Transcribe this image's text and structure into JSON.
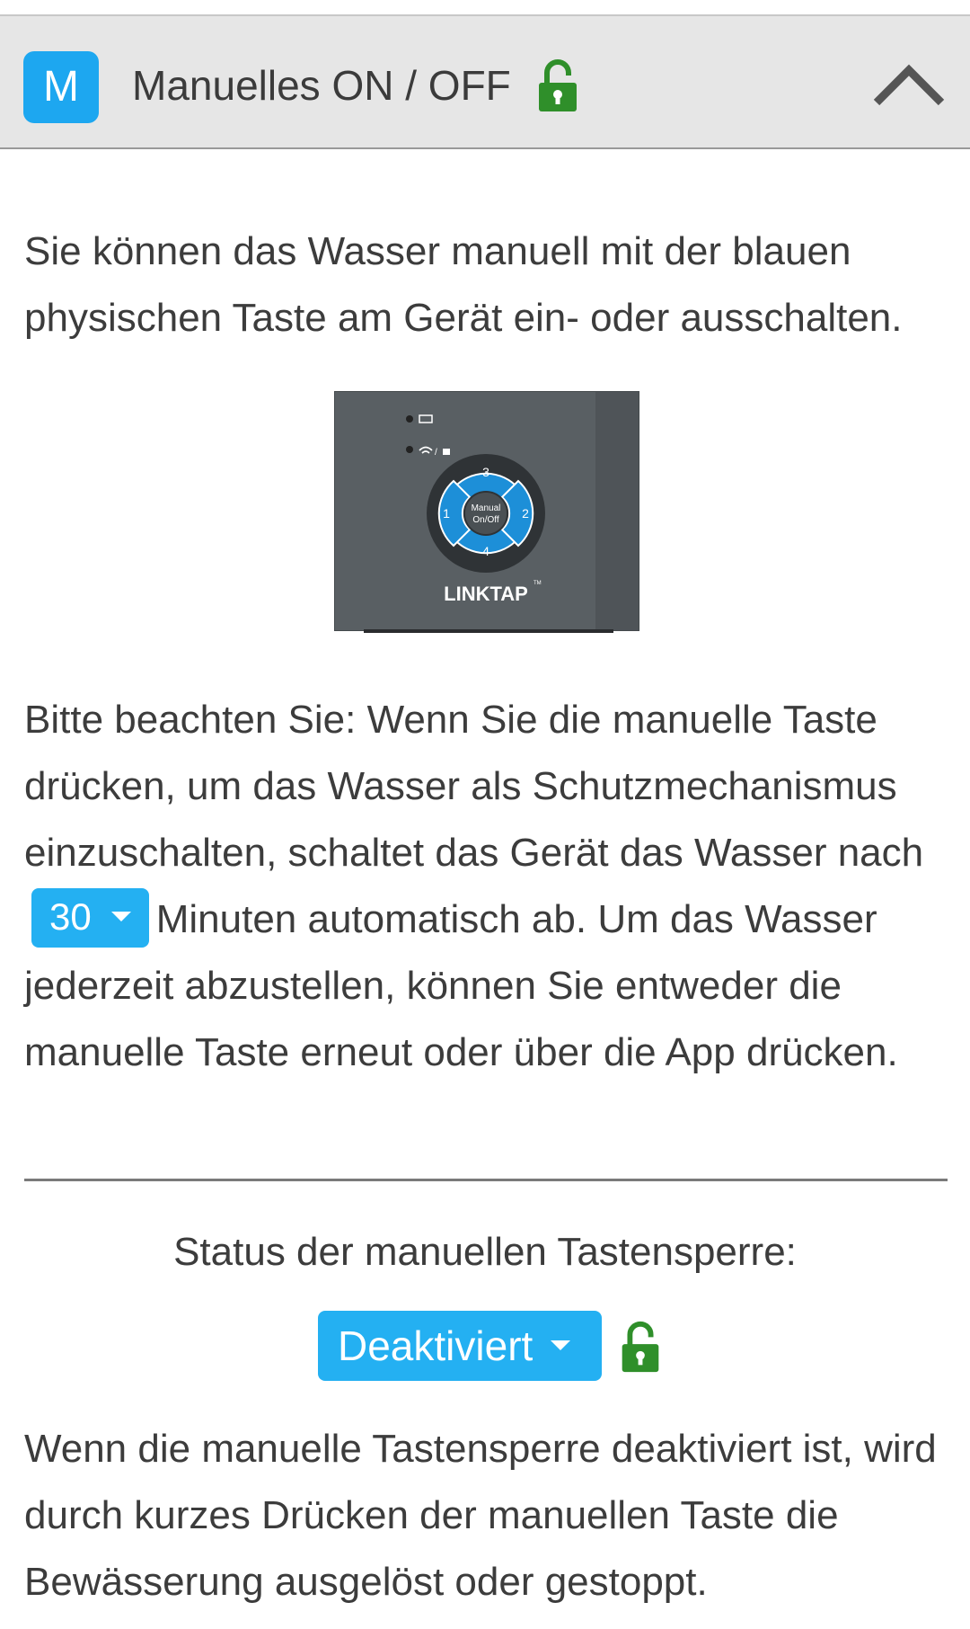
{
  "header": {
    "badge": "M",
    "title": "Manuelles ON / OFF",
    "lock_icon": "unlocked-padlock-icon",
    "collapse_icon": "chevron-up-icon"
  },
  "intro": {
    "text": "Sie können das Wasser manuell mit der blauen physischen Taste am Gerät ein- oder ausschalten."
  },
  "device_image": {
    "buttons": {
      "top": "3",
      "left": "1",
      "right": "2",
      "bottom": "4",
      "center_line1": "Manual",
      "center_line2": "On/Off"
    },
    "brand": "LINKTAP",
    "tm": "TM"
  },
  "note": {
    "before": "Bitte beachten Sie: Wenn Sie die manuelle Taste drücken, um das Wasser als Schutzmechanismus einzuschalten, schaltet das Gerät das Wasser nach",
    "minutes_value": "30",
    "after": "Minuten automatisch ab. Um das Wasser jederzeit abzustellen, können Sie entweder die manuelle Taste erneut oder über die App drücken."
  },
  "lock_status": {
    "label": "Status der manuellen Tastensperre:",
    "value": "Deaktiviert"
  },
  "description": {
    "text": "Wenn die manuelle Tastensperre deaktiviert ist, wird durch kurzes Drücken der manuellen Taste die Bewässerung ausgelöst oder gestoppt."
  },
  "colors": {
    "accent": "#24b0f2",
    "lock_green": "#2f8f2a",
    "header_bg": "#e6e6e6"
  }
}
